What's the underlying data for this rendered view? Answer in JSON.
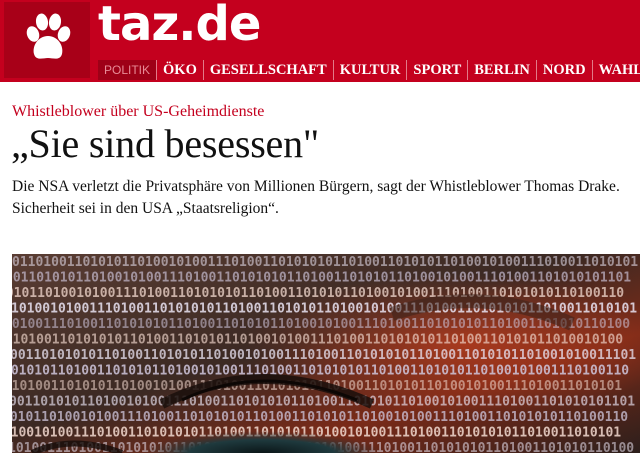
{
  "site": {
    "name": "taz.de"
  },
  "nav": {
    "items": [
      {
        "label": "POLITIK",
        "active": true
      },
      {
        "label": "ÖKO",
        "active": false
      },
      {
        "label": "GESELLSCHAFT",
        "active": false
      },
      {
        "label": "KULTUR",
        "active": false
      },
      {
        "label": "SPORT",
        "active": false
      },
      {
        "label": "BERLIN",
        "active": false
      },
      {
        "label": "NORD",
        "active": false
      },
      {
        "label": "WAHL",
        "active": false
      }
    ]
  },
  "article": {
    "kicker": "Whistleblower über US-Geheimdienste",
    "headline": "„Sie sind besessen\"",
    "lead": "Die NSA verletzt die Privatsphäre von Millionen Bürgern, sagt der Whistleblower Thomas Drake. Sicherheit sei in den USA „Staatsreligion“."
  },
  "image": {
    "icon": "binary-code-eye-photo",
    "binary_text": "0110100110101011010010100111010011010101"
  },
  "colors": {
    "brand_red": "#c4001e",
    "nav_active_bg": "#9e0017",
    "text": "#111111"
  }
}
